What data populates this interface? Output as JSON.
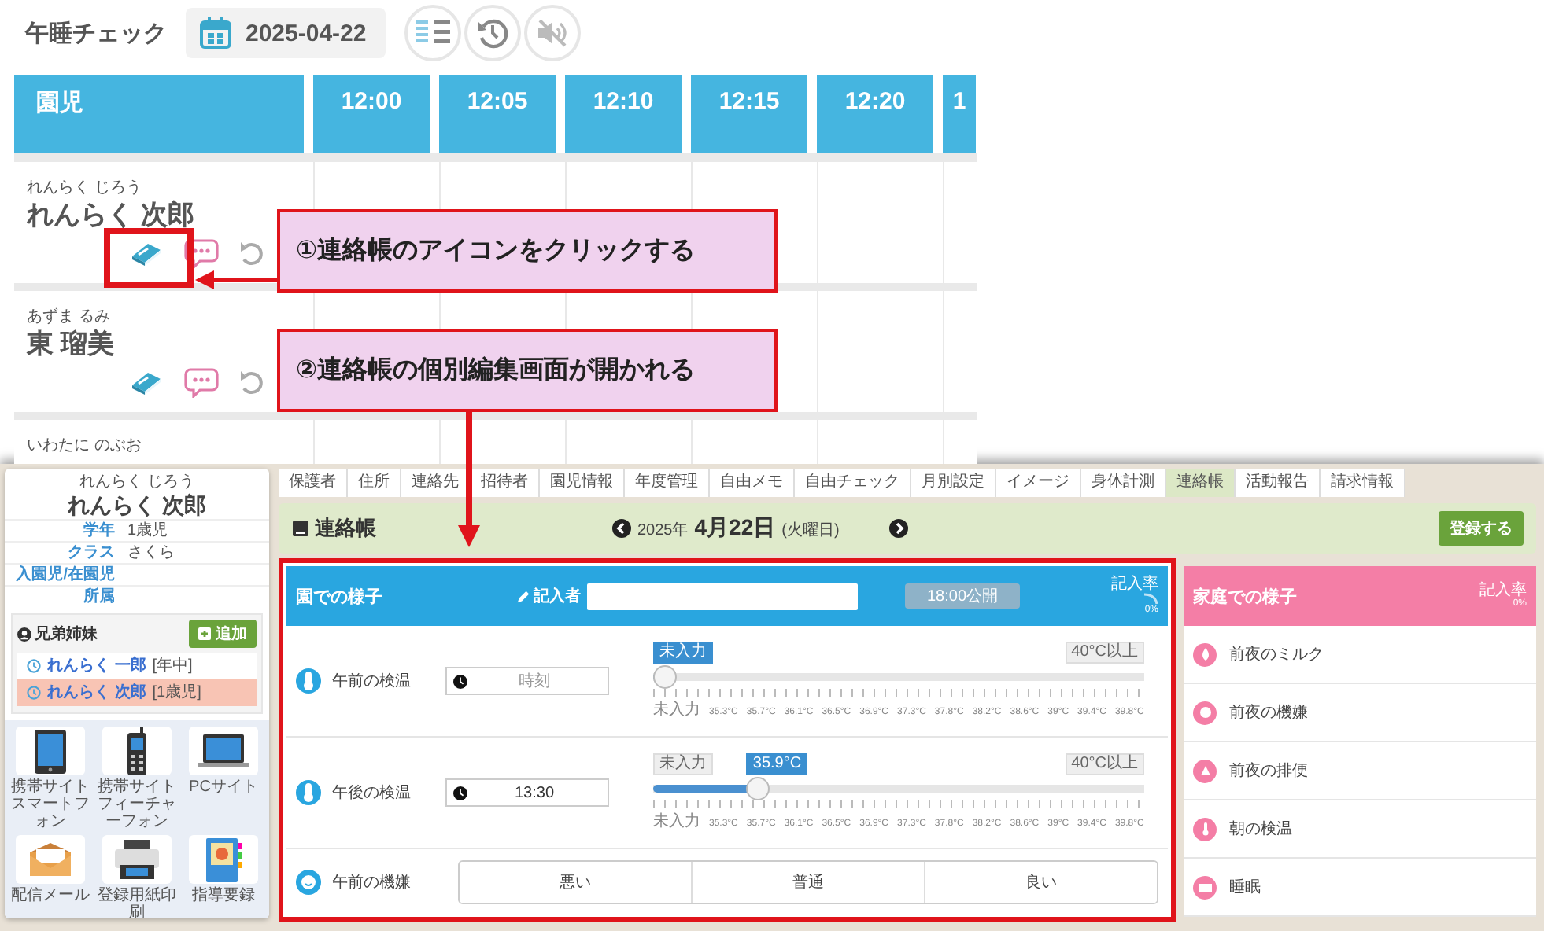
{
  "nap_check": {
    "title": "午睡チェック",
    "date": "2025-04-22",
    "table": {
      "columns": [
        "園児",
        "12:00",
        "12:05",
        "12:10",
        "12:15",
        "12:20",
        "1"
      ],
      "rows": [
        {
          "furigana": "れんらく じろう",
          "name": "れんらく 次郎"
        },
        {
          "furigana": "あずま るみ",
          "name": "東 瑠美"
        },
        {
          "furigana": "いわたに のぶお"
        }
      ]
    }
  },
  "callouts": [
    {
      "text": "①連絡帳のアイコンをクリックする"
    },
    {
      "text": "②連絡帳の個別編集画面が開かれる"
    }
  ],
  "child_screen": {
    "profile": {
      "furigana": "れんらく じろう",
      "name": "れんらく 次郎",
      "fields": [
        {
          "label": "学年",
          "value": "1歳児"
        },
        {
          "label": "クラス",
          "value": "さくら"
        },
        {
          "label": "入園児/在園児"
        },
        {
          "label": "所属"
        }
      ]
    },
    "siblings": {
      "title": "兄弟姉妹",
      "add_button": "追加",
      "items": [
        {
          "name": "れんらく 一郎",
          "grade": "[年中]",
          "selected": false
        },
        {
          "name": "れんらく 次郎",
          "grade": "[1歳児]",
          "selected": true
        }
      ]
    },
    "links": [
      {
        "label": "携帯サイトスマートフォン"
      },
      {
        "label": "携帯サイトフィーチャーフォン"
      },
      {
        "label": "PCサイト"
      },
      {
        "label": "配信メール"
      },
      {
        "label": "登録用紙印刷"
      },
      {
        "label": "指導要録"
      }
    ],
    "tabs": [
      {
        "label": "保護者",
        "selected": false
      },
      {
        "label": "住所",
        "selected": false
      },
      {
        "label": "連絡先",
        "selected": false
      },
      {
        "label": "招待者",
        "selected": false
      },
      {
        "label": "園児情報",
        "selected": false
      },
      {
        "label": "年度管理",
        "selected": false
      },
      {
        "label": "自由メモ",
        "selected": false
      },
      {
        "label": "自由チェック",
        "selected": false
      },
      {
        "label": "月別設定",
        "selected": false
      },
      {
        "label": "イメージ",
        "selected": false
      },
      {
        "label": "身体計測",
        "selected": false
      },
      {
        "label": "連絡帳",
        "selected": true
      },
      {
        "label": "活動報告",
        "selected": false
      },
      {
        "label": "請求情報",
        "selected": false
      }
    ],
    "journal": {
      "title": "連絡帳",
      "year": "2025年",
      "date": "4月22日",
      "weekday": "(火曜日)",
      "save_button": "登録する"
    },
    "school": {
      "title": "園での様子",
      "writer_label": "記入者",
      "publish": "18:00公開",
      "rate_label": "記入率",
      "rate": "0%",
      "rows": [
        {
          "kind": "temperature",
          "label": "午前の検温",
          "time_field": {
            "placeholder": "時刻"
          },
          "value_label": "未入力",
          "max_label": "40°C以上",
          "level": 0,
          "ticks": [
            "未入力",
            "35.3°C",
            "35.7°C",
            "36.1°C",
            "36.5°C",
            "36.9°C",
            "37.3°C",
            "37.8°C",
            "38.2°C",
            "38.6°C",
            "39°C",
            "39.4°C",
            "39.8°C"
          ]
        },
        {
          "kind": "temperature",
          "label": "午後の検温",
          "time_field": {
            "value": "13:30"
          },
          "min_label": "未入力",
          "value_label": "35.9°C",
          "max_label": "40°C以上",
          "level": 0.2,
          "ticks": [
            "未入力",
            "35.3°C",
            "35.7°C",
            "36.1°C",
            "36.5°C",
            "36.9°C",
            "37.3°C",
            "37.8°C",
            "38.2°C",
            "38.6°C",
            "39°C",
            "39.4°C",
            "39.8°C"
          ]
        },
        {
          "kind": "mood",
          "label": "午前の機嫌",
          "options": [
            {
              "label": "悪い",
              "selected": false
            },
            {
              "label": "普通",
              "selected": false
            },
            {
              "label": "良い",
              "selected": false
            }
          ]
        }
      ]
    },
    "home": {
      "title": "家庭での様子",
      "rate_label": "記入率",
      "rate": "0%",
      "items": [
        {
          "label": "前夜のミルク"
        },
        {
          "label": "前夜の機嫌"
        },
        {
          "label": "前夜の排便"
        },
        {
          "label": "朝の検温"
        },
        {
          "label": "睡眠"
        }
      ]
    }
  }
}
